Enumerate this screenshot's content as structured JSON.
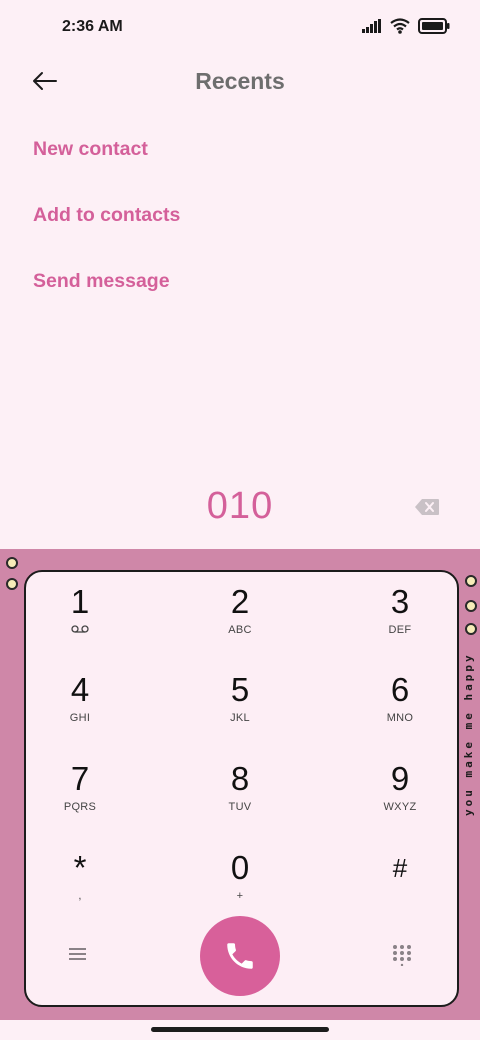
{
  "status_bar": {
    "time": "2:36 AM"
  },
  "header": {
    "title": "Recents"
  },
  "menu": {
    "items": [
      {
        "label": "New contact"
      },
      {
        "label": "Add to contacts"
      },
      {
        "label": "Send message"
      }
    ]
  },
  "dialer": {
    "number": "010"
  },
  "side_text": "you make me happy",
  "keys": [
    {
      "digit": "1",
      "letters": ""
    },
    {
      "digit": "2",
      "letters": "ABC"
    },
    {
      "digit": "3",
      "letters": "DEF"
    },
    {
      "digit": "4",
      "letters": "GHI"
    },
    {
      "digit": "5",
      "letters": "JKL"
    },
    {
      "digit": "6",
      "letters": "MNO"
    },
    {
      "digit": "7",
      "letters": "PQRS"
    },
    {
      "digit": "8",
      "letters": "TUV"
    },
    {
      "digit": "9",
      "letters": "WXYZ"
    },
    {
      "digit": "*",
      "letters": ","
    },
    {
      "digit": "0",
      "letters": "+"
    },
    {
      "digit": "#",
      "letters": ""
    }
  ],
  "colors": {
    "accent": "#d4609a",
    "background": "#fdf0f6",
    "frame": "#cf87a8",
    "call_button": "#d8609a"
  },
  "icons": {
    "back": "arrow-left-icon",
    "backspace": "backspace-icon",
    "voicemail": "voicemail-icon",
    "call": "phone-icon",
    "menu": "hamburger-icon",
    "dialpad": "dialpad-grid-icon"
  }
}
